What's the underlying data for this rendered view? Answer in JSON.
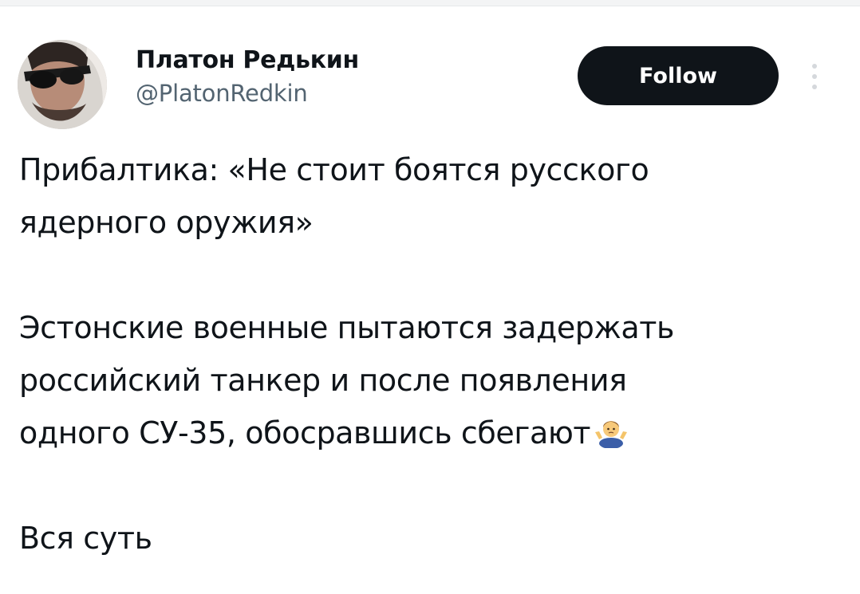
{
  "author": {
    "display_name": "Платон Редькин",
    "handle": "@PlatonRedkin"
  },
  "actions": {
    "follow_label": "Follow"
  },
  "tweet": {
    "lines": [
      "Прибалтика: «Не стоит боятся русского",
      "ядерного оружия»",
      "",
      "Эстонские военные пытаются задержать",
      "российский танкер и после появления",
      "одного СУ-35, обосравшись сбегают",
      "",
      "Вся суть"
    ],
    "emoji": "man-shrugging-icon"
  },
  "colors": {
    "text": "#0f1419",
    "secondary_text": "#536471",
    "button_bg": "#0f1419",
    "button_text": "#ffffff"
  }
}
